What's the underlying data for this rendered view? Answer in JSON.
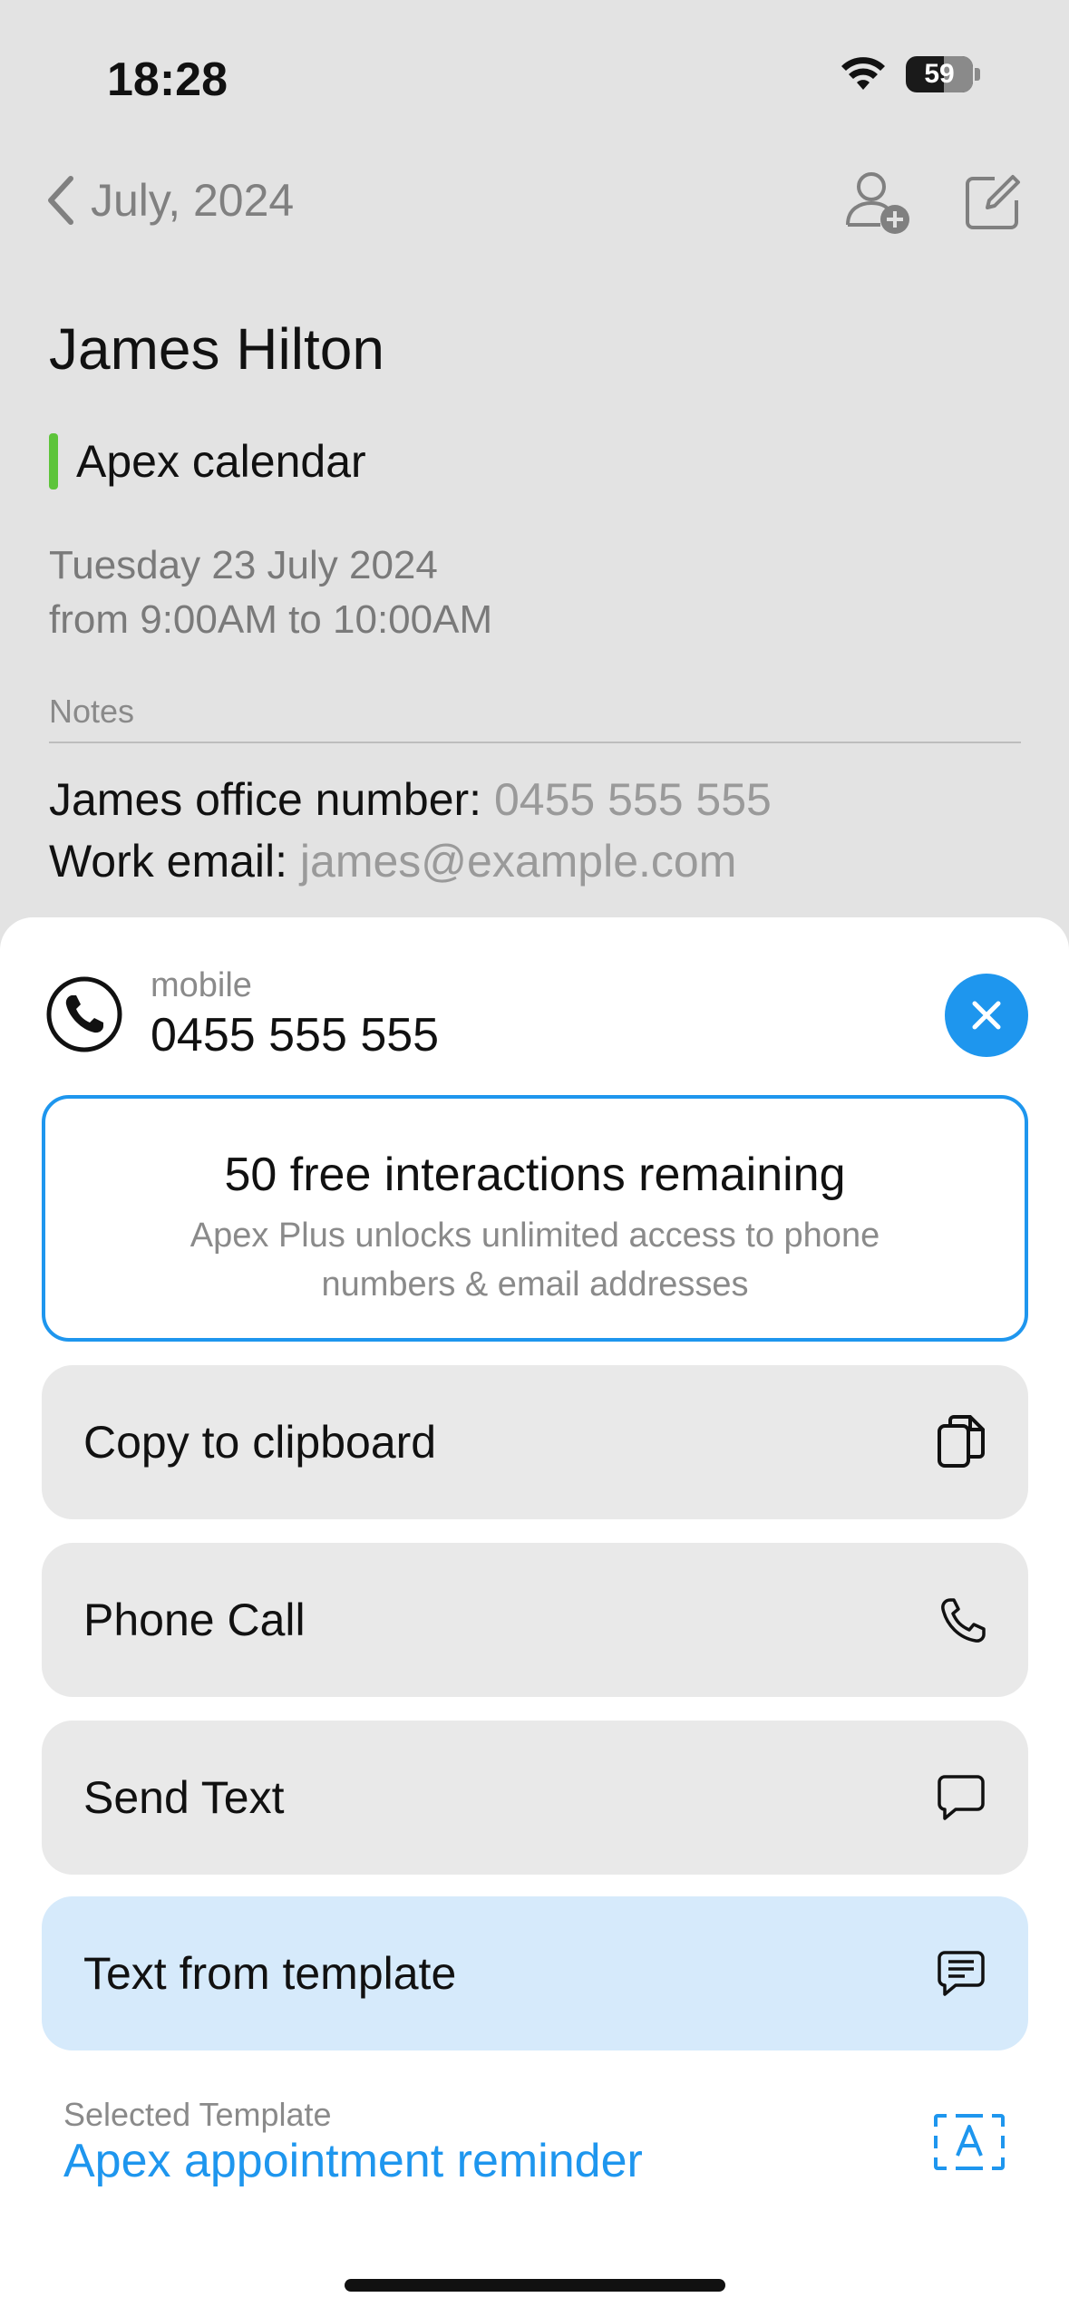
{
  "status": {
    "time": "18:28",
    "battery": "59"
  },
  "nav": {
    "back_label": "July, 2024"
  },
  "event": {
    "title": "James Hilton",
    "calendar": "Apex calendar",
    "calendar_color": "#5dc43a",
    "date_line1": "Tuesday 23 July 2024",
    "date_line2": "from 9:00AM to 10:00AM",
    "notes_label": "Notes",
    "office_label": "James office number: ",
    "office_value": "0455 555 555",
    "email_label": "Work email: ",
    "email_value": "james@example.com"
  },
  "sheet": {
    "contact_type": "mobile",
    "contact_number": "0455 555 555",
    "promo_title": "50 free interactions remaining",
    "promo_subtitle": "Apex Plus unlocks unlimited access to phone numbers & email addresses",
    "actions": {
      "copy": "Copy to clipboard",
      "call": "Phone Call",
      "text": "Send Text",
      "template": "Text from template"
    },
    "selected_template_label": "Selected Template",
    "selected_template_name": "Apex appointment reminder"
  },
  "colors": {
    "accent": "#1e96ee",
    "highlight": "#d6eafb"
  },
  "icons": [
    "wifi-icon",
    "battery-icon",
    "chevron-left-icon",
    "add-person-icon",
    "compose-icon",
    "phone-circle-icon",
    "close-icon",
    "copy-icon",
    "phone-icon",
    "message-icon",
    "message-template-icon",
    "text-template-icon"
  ]
}
